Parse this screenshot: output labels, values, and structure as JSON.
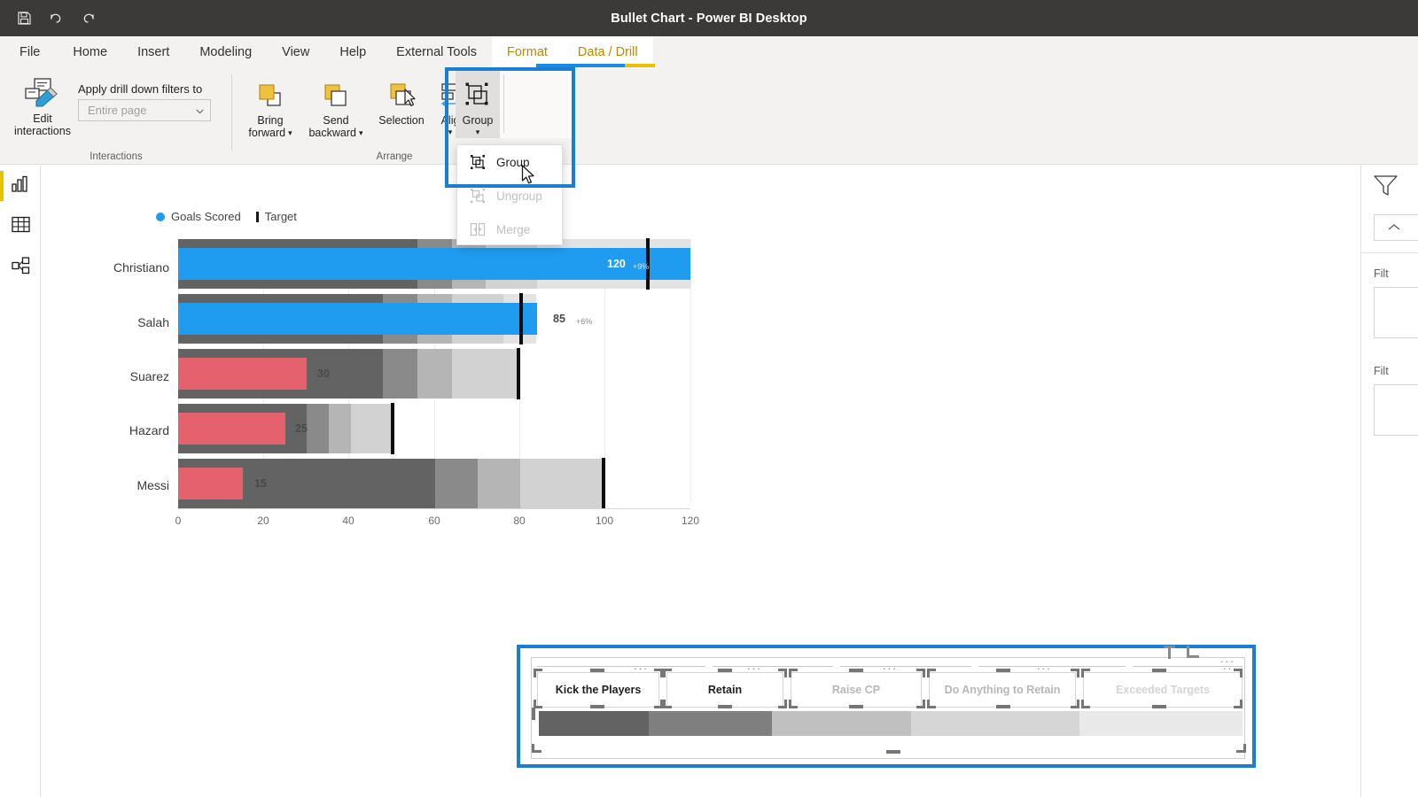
{
  "titlebar": {
    "title": "Bullet Chart - Power BI Desktop",
    "quick_access": [
      {
        "name": "save-icon",
        "label": "Save"
      },
      {
        "name": "undo-icon",
        "label": "Undo"
      },
      {
        "name": "redo-icon",
        "label": "Redo"
      }
    ]
  },
  "ribbon": {
    "tabs": [
      {
        "label": "File",
        "active": false
      },
      {
        "label": "Home",
        "active": false
      },
      {
        "label": "Insert",
        "active": false
      },
      {
        "label": "Modeling",
        "active": false
      },
      {
        "label": "View",
        "active": false
      },
      {
        "label": "Help",
        "active": false
      },
      {
        "label": "External Tools",
        "active": false
      },
      {
        "label": "Format",
        "active": false,
        "contextual": true
      },
      {
        "label": "Data / Drill",
        "active": true,
        "contextual": true
      }
    ],
    "groups": [
      {
        "label": "Interactions"
      },
      {
        "label": "Arrange"
      }
    ],
    "interactions": {
      "edit_interactions_label_line1": "Edit",
      "edit_interactions_label_line2": "interactions",
      "drill_filters_label": "Apply drill down filters to",
      "drill_filters_value": "Entire page"
    },
    "arrange": {
      "bring_forward_line1": "Bring",
      "bring_forward_line2": "forward",
      "send_backward_line1": "Send",
      "send_backward_line2": "backward",
      "selection_label": "Selection",
      "align_label": "Alig",
      "group_label": "Group"
    },
    "group_menu": {
      "items": [
        {
          "label": "Group",
          "enabled": true,
          "icon": "group-icon"
        },
        {
          "label": "Ungroup",
          "enabled": false,
          "icon": "ungroup-icon"
        },
        {
          "label": "Merge",
          "enabled": false,
          "icon": "merge-icon"
        }
      ]
    }
  },
  "left_rail": {
    "items": [
      {
        "name": "report-view",
        "icon": "bar-chart-icon",
        "active": true
      },
      {
        "name": "data-view",
        "icon": "table-icon",
        "active": false
      },
      {
        "name": "model-view",
        "icon": "model-icon",
        "active": false
      }
    ]
  },
  "right_pane": {
    "filters_title": "Filt",
    "filter_label_1": "Filt",
    "filter_label_2": "Filt"
  },
  "chart_data": {
    "type": "bar",
    "title": "",
    "subtype": "bullet",
    "legend": [
      {
        "label": "Goals Scored",
        "color": "#1f9bf0",
        "marker": "dot"
      },
      {
        "label": "Target",
        "color": "#0d0d0d",
        "marker": "tick"
      }
    ],
    "legend_position": "top-left",
    "categories": [
      "Christiano",
      "Salah",
      "Suarez",
      "Hazard",
      "Messi"
    ],
    "xlabel": "",
    "ylabel": "",
    "xlim": [
      0,
      120
    ],
    "xticks": [
      0,
      20,
      40,
      60,
      80,
      100,
      120
    ],
    "grid": true,
    "series": [
      {
        "name": "Goals Scored",
        "values": [
          120,
          85,
          30,
          25,
          15
        ]
      },
      {
        "name": "Target",
        "values": [
          110,
          80,
          80,
          50,
          100
        ]
      }
    ],
    "data_labels": [
      {
        "category": "Christiano",
        "value": "120",
        "delta": "+9%",
        "inside_bar": true
      },
      {
        "category": "Salah",
        "value": "85",
        "delta": "+6%",
        "inside_bar": false
      },
      {
        "category": "Suarez",
        "value": "30",
        "delta": "",
        "inside_bar": false
      },
      {
        "category": "Hazard",
        "value": "25",
        "delta": "",
        "inside_bar": false
      },
      {
        "category": "Messi",
        "value": "15",
        "delta": "",
        "inside_bar": false
      }
    ],
    "bar_colors": {
      "above_target": "#1f9bf0",
      "below_target": "#e5616e",
      "target_marker": "#0d0d0d"
    },
    "qualitative_bands": {
      "colors": [
        "#636363",
        "#8a8a8a",
        "#b5b5b5",
        "#d2d2d2",
        "#e3e3e3"
      ],
      "by_category": {
        "Christiano": [
          56,
          64,
          72,
          84,
          120
        ],
        "Salah": [
          48,
          52,
          56,
          60,
          84
        ],
        "Suarez": [
          48,
          56,
          64,
          80,
          80
        ],
        "Hazard": [
          30,
          35,
          40,
          50,
          50
        ],
        "Messi": [
          60,
          70,
          80,
          100,
          100
        ]
      }
    }
  },
  "selected_group": {
    "textboxes": [
      {
        "label": "Kick the Players",
        "state": "normal"
      },
      {
        "label": "Retain",
        "state": "normal"
      },
      {
        "label": "Raise CP",
        "state": "faded",
        "misspelled": "CP"
      },
      {
        "label": "Do Anything to Retain",
        "state": "faded"
      },
      {
        "label": "Exceeded Targets",
        "state": "faded2"
      }
    ],
    "gradient_segments": [
      {
        "color": "#636363"
      },
      {
        "color": "#7f7f7f"
      },
      {
        "color": "#c0c0c0"
      },
      {
        "color": "#d6d6d6"
      },
      {
        "color": "#e9e9e9"
      }
    ],
    "overflow_menu": "..."
  }
}
